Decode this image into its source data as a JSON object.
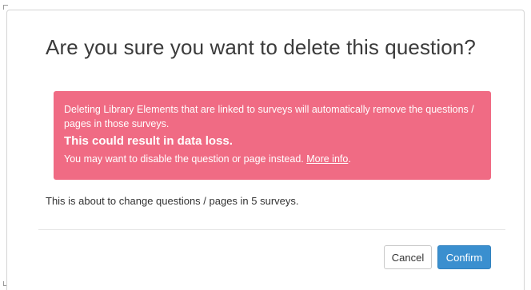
{
  "dialog": {
    "title": "Are you sure you want to delete this question?",
    "alert": {
      "message": "Deleting Library Elements that are linked to surveys will automatically remove the questions / pages in those surveys.",
      "warning": "This could result in data loss.",
      "suggestion": "You may want to disable the question or page instead.",
      "link_label": "More info",
      "link_suffix": "."
    },
    "summary": "This is about to change questions / pages in 5 surveys.",
    "buttons": {
      "cancel_label": "Cancel",
      "confirm_label": "Confirm"
    }
  },
  "colors": {
    "alert_background": "#f06b84",
    "confirm_background": "#3a8fcf"
  }
}
